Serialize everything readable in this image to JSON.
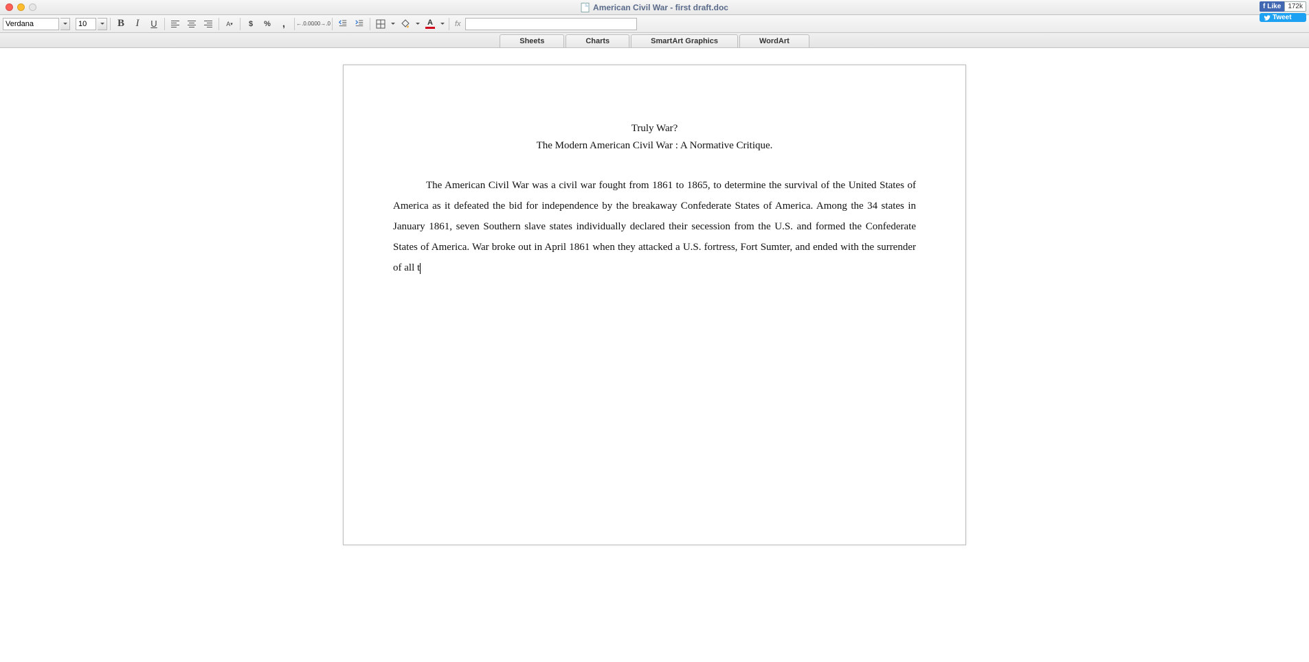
{
  "window": {
    "title": "American Civil War - first draft.doc"
  },
  "social": {
    "fb_like": "Like",
    "fb_count": "172k",
    "tweet": "Tweet"
  },
  "toolbar": {
    "font": "Verdana",
    "size": "10",
    "fx": "fx"
  },
  "tabs": [
    "Sheets",
    "Charts",
    "SmartArt Graphics",
    "WordArt"
  ],
  "document": {
    "title": "Truly War?",
    "subtitle": "The Modern American Civil War : A Normative Critique.",
    "body": "The American Civil War was a civil war fought from 1861 to 1865, to determine the survival of the United States of America as it defeated the bid for independence by the breakaway Confederate States of America. Among the 34 states in January 1861, seven Southern slave states individually declared their secession from the U.S. and formed the Confederate States of America. War broke out in April 1861 when they attacked a U.S. fortress, Fort Sumter, and ended with the surrender of all t"
  }
}
